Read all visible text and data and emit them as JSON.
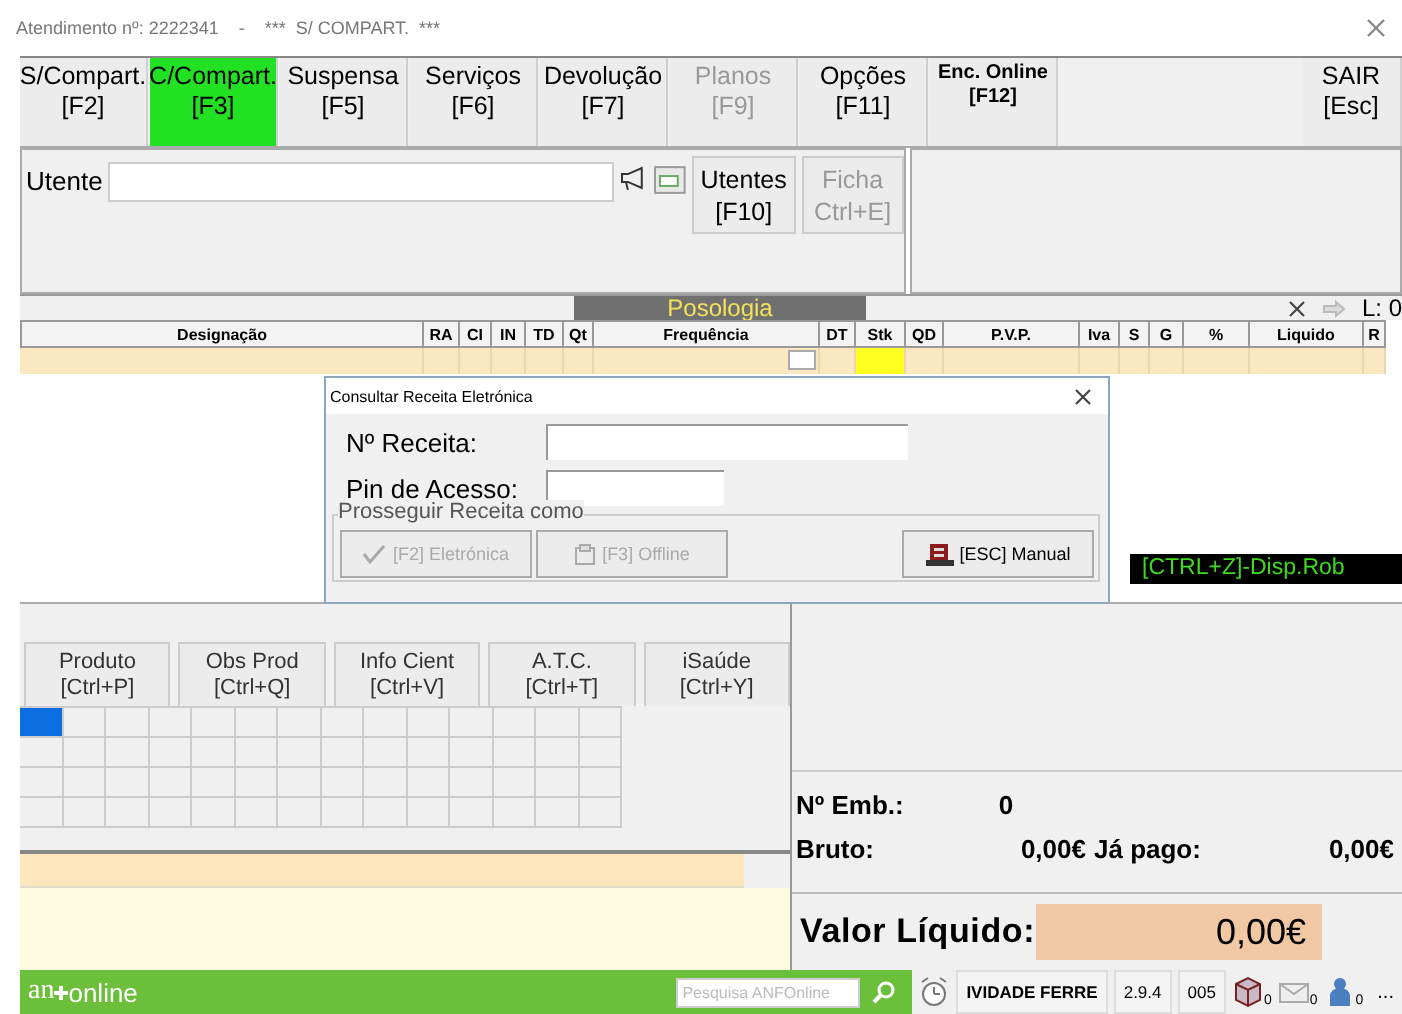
{
  "window": {
    "title": "Atendimento nº: 2222341    -    ***  S/ COMPART.  ***"
  },
  "toolbar": {
    "buttons": [
      {
        "label": "S/Compart.",
        "key": "[F2]",
        "selected": false,
        "disabled": false
      },
      {
        "label": "C/Compart.",
        "key": "[F3]",
        "selected": true,
        "disabled": false
      },
      {
        "label": "Suspensa",
        "key": "[F5]",
        "selected": false,
        "disabled": false
      },
      {
        "label": "Serviços",
        "key": "[F6]",
        "selected": false,
        "disabled": false
      },
      {
        "label": "Devolução",
        "key": "[F7]",
        "selected": false,
        "disabled": false
      },
      {
        "label": "Planos",
        "key": "[F9]",
        "selected": false,
        "disabled": true
      },
      {
        "label": "Opções",
        "key": "[F11]",
        "selected": false,
        "disabled": false
      },
      {
        "label": "Enc. Online",
        "key": "[F12]",
        "selected": false,
        "disabled": false,
        "kind": "small"
      }
    ],
    "exit": {
      "label": "SAIR",
      "key": "[Esc]"
    }
  },
  "utente": {
    "label": "Utente",
    "buttons": [
      {
        "label": "Utentes",
        "key": "[F10]",
        "disabled": false
      },
      {
        "label": "Ficha",
        "key": "Ctrl+E]",
        "disabled": true
      }
    ]
  },
  "posologia": {
    "title": "Posologia",
    "line_count": "L: 0"
  },
  "table": {
    "columns": [
      "Designação",
      "RA",
      "CI",
      "IN",
      "TD",
      "Qt",
      "Frequência",
      "DT",
      "Stk",
      "QD",
      "P.V.P.",
      "Iva",
      "S",
      "G",
      "%",
      "Liquido",
      "R"
    ]
  },
  "dialog": {
    "title": "Consultar Receita Eletrónica",
    "fields": [
      {
        "label": "Nº Receita:"
      },
      {
        "label": "Pin de Acesso:"
      }
    ],
    "group": "Prosseguir Receita como",
    "buttons": [
      {
        "label": "[F2] Eletrónica",
        "disabled": true,
        "kind": "check"
      },
      {
        "label": "[F3] Offline",
        "disabled": true,
        "kind": "offline"
      },
      {
        "label": "[ESC] Manual",
        "disabled": false,
        "kind": "manual"
      }
    ]
  },
  "robot_label": "[CTRL+Z]-Disp.Rob",
  "info_tabs": [
    {
      "label": "Produto",
      "key": "[Ctrl+P]"
    },
    {
      "label": "Obs Prod",
      "key": "[Ctrl+Q]"
    },
    {
      "label": "Info Cient",
      "key": "[Ctrl+V]"
    },
    {
      "label": "A.T.C.",
      "key": "[Ctrl+T]"
    },
    {
      "label": "iSaúde",
      "key": "[Ctrl+Y]"
    }
  ],
  "totals": {
    "packages_label": "Nº Emb.:",
    "packages": "0",
    "gross_label": "Bruto:",
    "gross": "0,00€",
    "paid_label": "Já pago:",
    "paid": "0,00€",
    "net_label": "Valor Líquido:",
    "net": "0,00€"
  },
  "status_bar": {
    "logo_prefix": "an",
    "logo_suffix": "online",
    "search_placeholder": "Pesquisa ANFOnline",
    "cells": [
      "IVIDADE FERRE",
      "2.9.4",
      "005"
    ],
    "icons": [
      {
        "kind": "box",
        "badge": "0"
      },
      {
        "kind": "mail",
        "badge": "0"
      },
      {
        "kind": "person",
        "badge": "0"
      }
    ],
    "more": "..."
  }
}
